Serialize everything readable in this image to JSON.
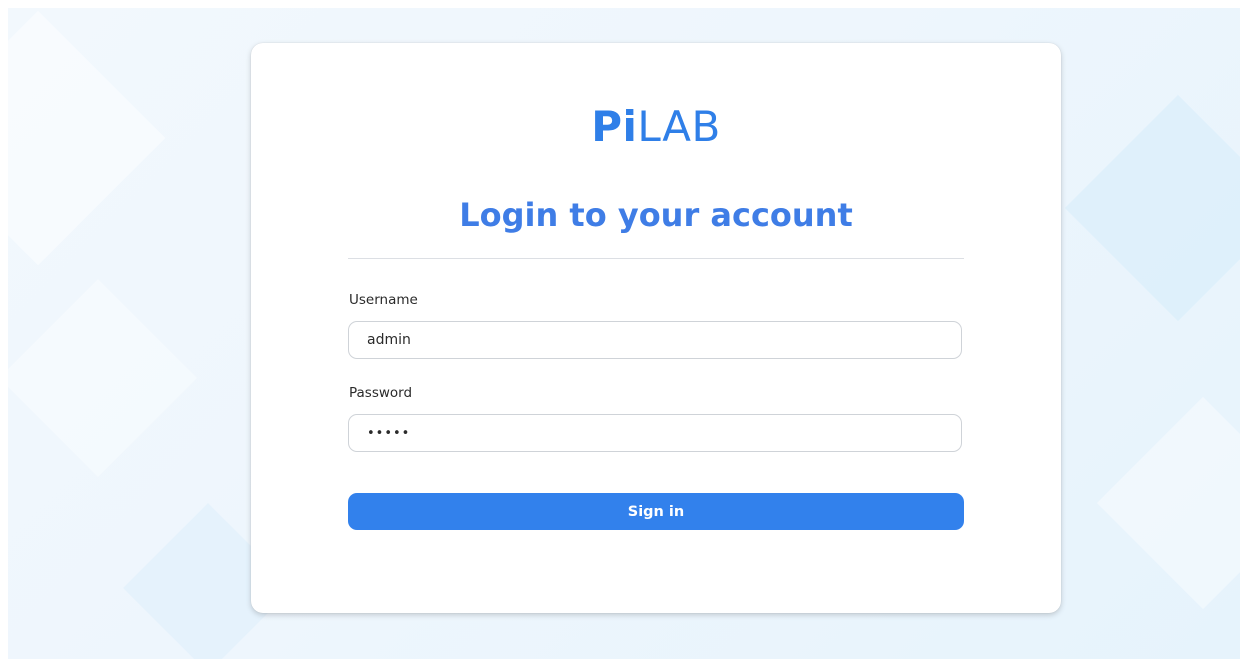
{
  "logo": {
    "bold_part": "Pi",
    "light_part": "LAB"
  },
  "heading": "Login to your account",
  "form": {
    "username_label": "Username",
    "username_value": "admin",
    "password_label": "Password",
    "password_value": "•••••"
  },
  "buttons": {
    "signin_label": "Sign in"
  },
  "colors": {
    "brand": "#2f7fe8",
    "button": "#3281ec",
    "background": "#eef6fd"
  }
}
